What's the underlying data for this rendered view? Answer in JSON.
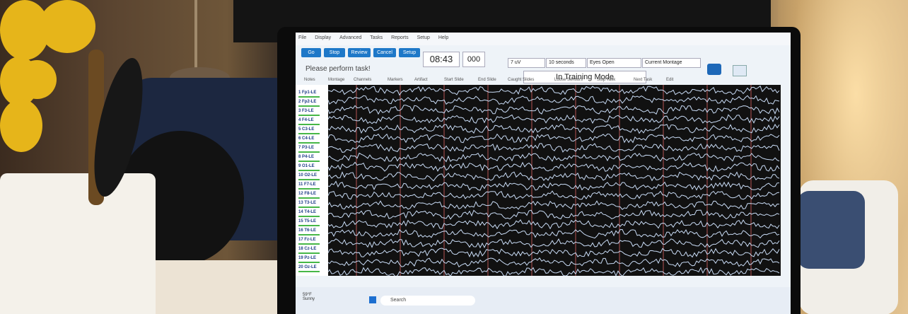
{
  "photo": {
    "description_visible_scene": ""
  },
  "app": {
    "menu": [
      "File",
      "Display",
      "Advanced",
      "Tasks",
      "Reports",
      "Setup",
      "Help"
    ],
    "toolbar_buttons": [
      "Go",
      "Stop",
      "Review",
      "Cancel",
      "Setup"
    ],
    "timer": "08:43",
    "counter": "000",
    "selects": [
      "7 uV",
      "10 seconds",
      "Eyes Open",
      "Current Montage"
    ],
    "prompt": "Please perform task!",
    "mode": "In Training Mode",
    "tabs": [
      "Notes",
      "Montage",
      "Channels",
      "Markers",
      "Artifact",
      "Start Slide",
      "End Slide",
      "Caught Slides",
      "Loose Sensors",
      "Stop Task",
      "Next Task",
      "Edit"
    ],
    "channels": [
      "1 Fp1-LE",
      "2 Fp2-LE",
      "3 F3-LE",
      "4 F4-LE",
      "5 C3-LE",
      "6 C4-LE",
      "7 P3-LE",
      "8 P4-LE",
      "9 O1-LE",
      "10 O2-LE",
      "11 F7-LE",
      "12 F8-LE",
      "13 T3-LE",
      "14 T4-LE",
      "15 T5-LE",
      "16 T6-LE",
      "17 Fz-LE",
      "18 Cz-LE",
      "19 Pz-LE",
      "20 Oz-LE"
    ],
    "taskbar": {
      "weather_temp": "59°F",
      "weather_state": "Sunny",
      "search_placeholder": "Search"
    },
    "colors": {
      "accent": "#1e78c8",
      "trace": "#c9dcf6",
      "marker": "#d66"
    }
  }
}
